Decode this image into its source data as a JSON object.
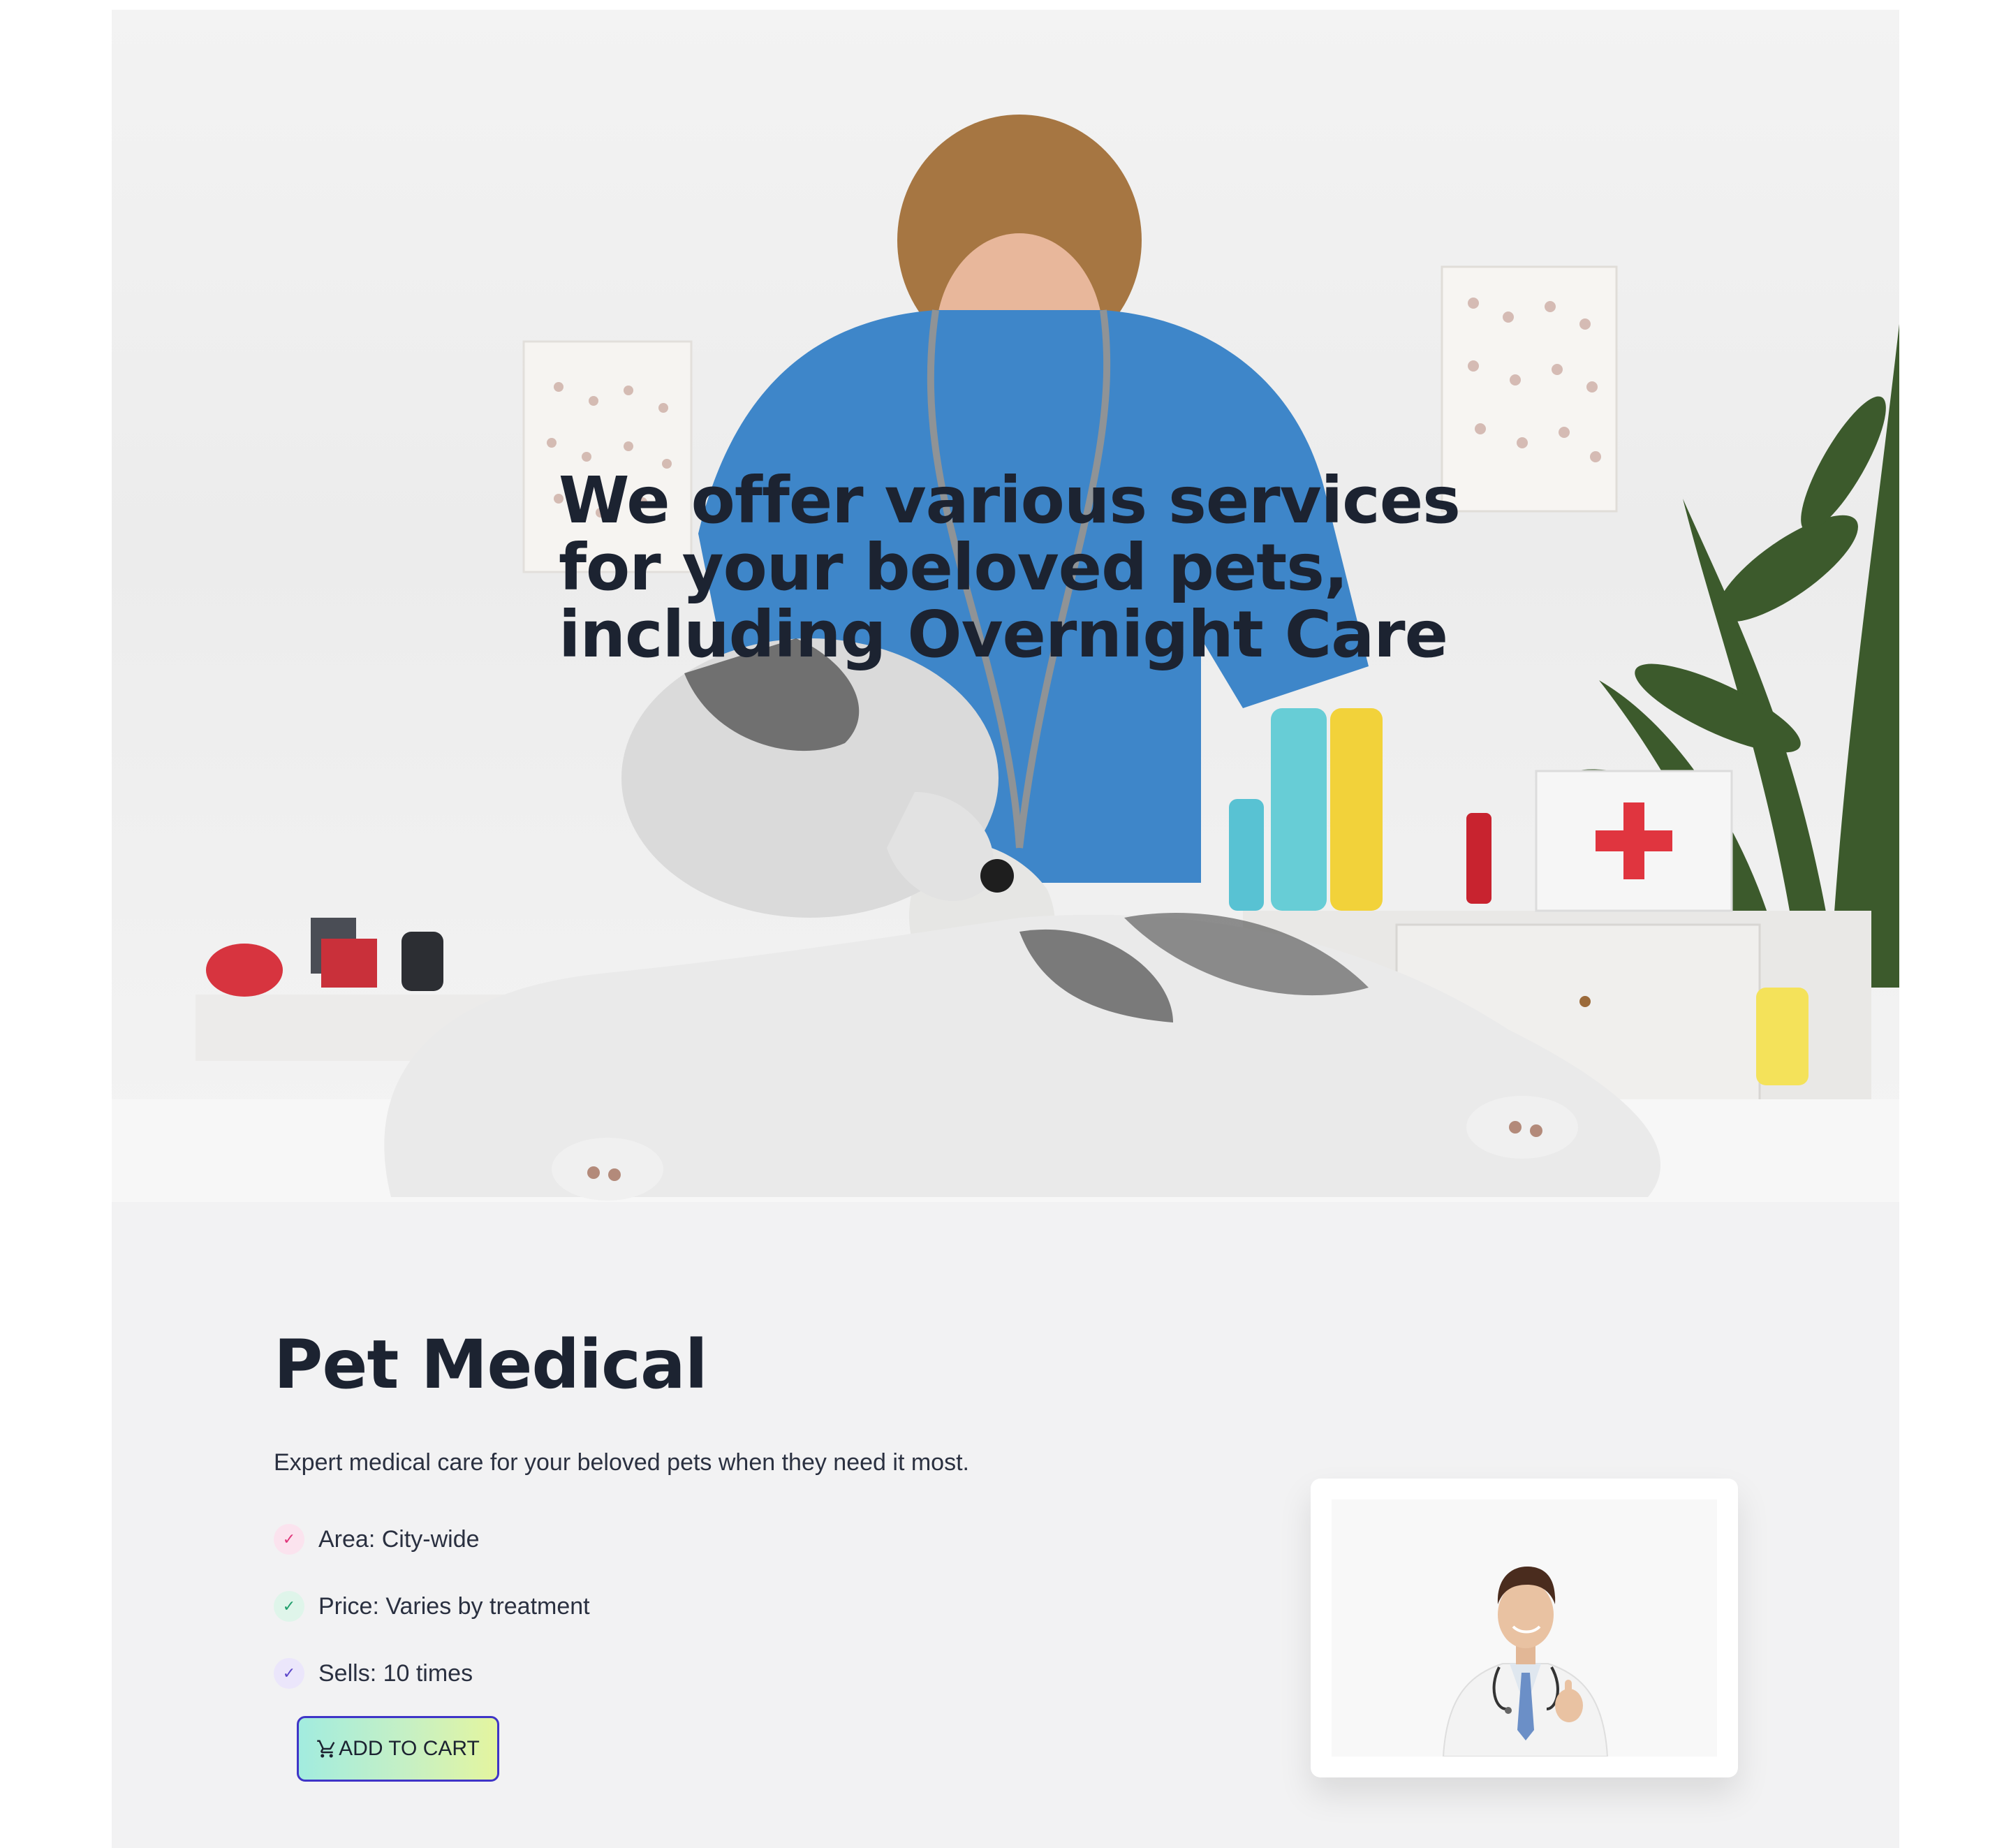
{
  "hero": {
    "title": "We offer various services for your beloved pets, including Overnight Care"
  },
  "product": {
    "title": "Pet Medical",
    "description": "Expert medical care for your beloved pets when they need it most.",
    "features": [
      {
        "label": "Area: City-wide",
        "color": "#e0357a",
        "bg": "#fbe3ee"
      },
      {
        "label": "Price: Varies by treatment",
        "color": "#1f9e6b",
        "bg": "#dff5ea"
      },
      {
        "label": "Sells: 10 times",
        "color": "#5b45c9",
        "bg": "#ebe6fb"
      }
    ],
    "add_to_cart": "ADD TO CART",
    "check_glyph": "✓"
  },
  "colors": {
    "accent_border": "#3f35c7",
    "heading": "#1c2331"
  }
}
